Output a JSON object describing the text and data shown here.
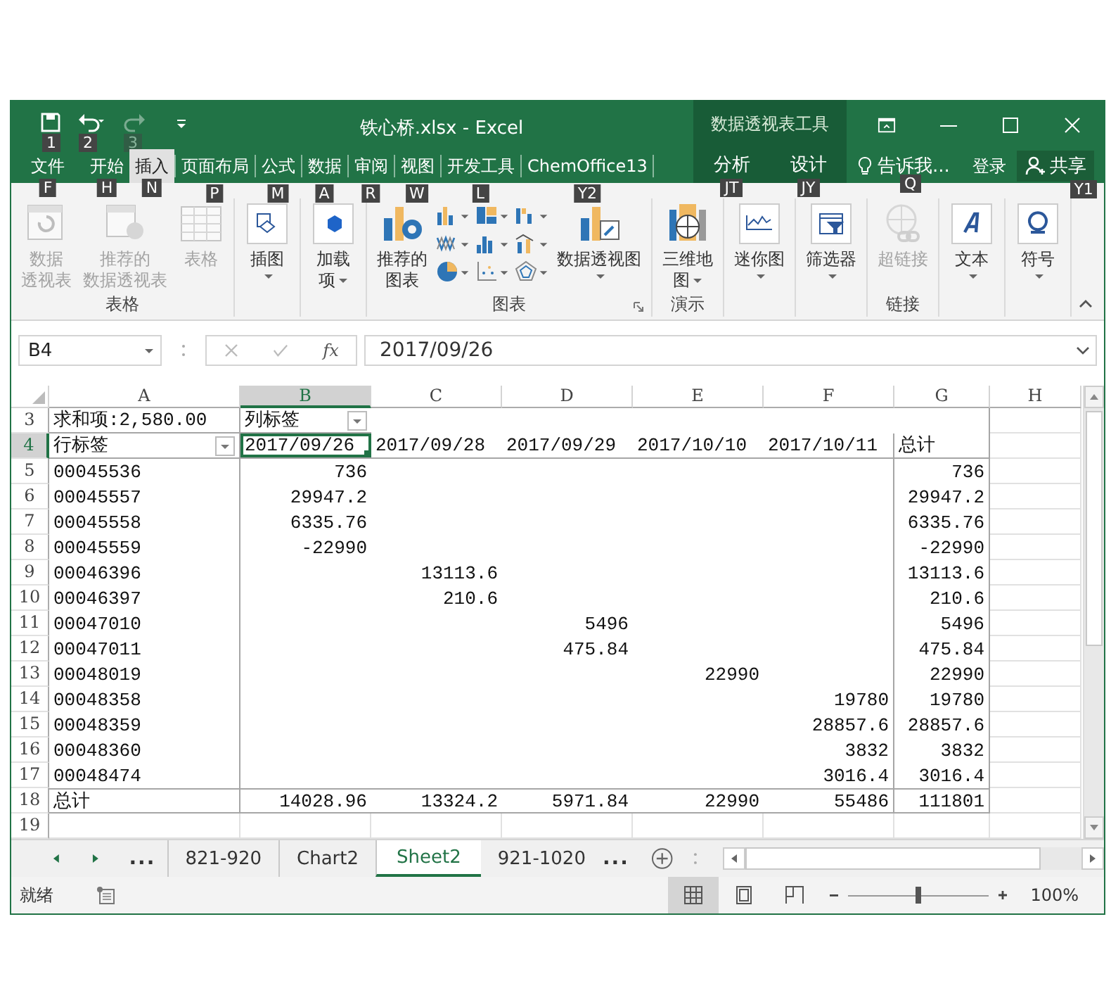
{
  "title_bar": {
    "quick_access": [
      {
        "keytip": "1",
        "disabled": false
      },
      {
        "keytip": "2",
        "disabled": false
      },
      {
        "keytip": "3",
        "disabled": true
      }
    ],
    "title": "铁心桥.xlsx - Excel",
    "contextual_label": "数据透视表工具"
  },
  "tabs": [
    {
      "label": "文件",
      "keytip": "F",
      "selected": false,
      "contextual": false
    },
    {
      "label": "开始",
      "keytip": "H",
      "selected": false,
      "contextual": false
    },
    {
      "label": "插入",
      "keytip": "N",
      "selected": true,
      "contextual": false
    },
    {
      "label": "页面布局",
      "keytip": "P",
      "selected": false,
      "contextual": false
    },
    {
      "label": "公式",
      "keytip": "M",
      "selected": false,
      "contextual": false
    },
    {
      "label": "数据",
      "keytip": "A",
      "selected": false,
      "contextual": false
    },
    {
      "label": "审阅",
      "keytip": "R",
      "selected": false,
      "contextual": false
    },
    {
      "label": "视图",
      "keytip": "W",
      "selected": false,
      "contextual": false
    },
    {
      "label": "开发工具",
      "keytip": "L",
      "selected": false,
      "contextual": false
    },
    {
      "label": "ChemOffice13",
      "keytip": "Y2",
      "selected": false,
      "contextual": false
    },
    {
      "label": "分析",
      "keytip": "JT",
      "selected": false,
      "contextual": true
    },
    {
      "label": "设计",
      "keytip": "JY",
      "selected": false,
      "contextual": true
    }
  ],
  "tell_me": {
    "placeholder": "告诉我...",
    "keytip": "Q"
  },
  "sign_in": "登录",
  "share": {
    "label": "共享",
    "keytip": "Y1"
  },
  "ribbon": {
    "groups": [
      {
        "label": "表格",
        "items": [
          {
            "kind": "large",
            "lines": [
              "数据",
              "透视表"
            ],
            "disabled": true,
            "dropdown": false
          },
          {
            "kind": "large",
            "lines": [
              "推荐的",
              "数据透视表"
            ],
            "disabled": true,
            "dropdown": false
          },
          {
            "kind": "large",
            "lines": [
              "表格"
            ],
            "disabled": true,
            "dropdown": false
          }
        ]
      },
      {
        "items": [
          {
            "kind": "large",
            "lines": [
              "插图"
            ],
            "disabled": false,
            "dropdown": true
          }
        ]
      },
      {
        "items": [
          {
            "kind": "large",
            "lines": [
              "加载",
              "项"
            ],
            "disabled": false,
            "dropdown": true
          }
        ]
      },
      {
        "label": "图表",
        "launcher": true,
        "items": [
          {
            "kind": "large",
            "lines": [
              "推荐的",
              "图表"
            ],
            "disabled": false,
            "dropdown": false
          },
          {
            "kind": "chart_gallery"
          },
          {
            "kind": "large",
            "lines": [
              "数据透视图"
            ],
            "disabled": false,
            "dropdown": true
          }
        ]
      },
      {
        "label": "演示",
        "items": [
          {
            "kind": "large",
            "lines": [
              "三维地",
              "图"
            ],
            "disabled": false,
            "dropdown": true
          }
        ]
      },
      {
        "items": [
          {
            "kind": "large",
            "lines": [
              "迷你图"
            ],
            "disabled": false,
            "dropdown": true
          }
        ]
      },
      {
        "items": [
          {
            "kind": "large",
            "lines": [
              "筛选器"
            ],
            "disabled": false,
            "dropdown": true
          }
        ]
      },
      {
        "label": "链接",
        "items": [
          {
            "kind": "large",
            "lines": [
              "超链接"
            ],
            "disabled": true,
            "dropdown": false
          }
        ]
      },
      {
        "items": [
          {
            "kind": "large",
            "lines": [
              "文本"
            ],
            "disabled": false,
            "dropdown": true
          }
        ]
      },
      {
        "items": [
          {
            "kind": "large",
            "lines": [
              "符号"
            ],
            "disabled": false,
            "dropdown": true
          }
        ]
      }
    ]
  },
  "formula_bar": {
    "name_box": "B4",
    "function_label": "fx",
    "value": "2017/09/26"
  },
  "grid": {
    "columns": [
      {
        "label": "A",
        "selected": false
      },
      {
        "label": "B",
        "selected": true
      },
      {
        "label": "C",
        "selected": false
      },
      {
        "label": "D",
        "selected": false
      },
      {
        "label": "E",
        "selected": false
      },
      {
        "label": "F",
        "selected": false
      },
      {
        "label": "G",
        "selected": false
      },
      {
        "label": "H",
        "selected": false
      }
    ],
    "rows": [
      {
        "number": "3",
        "selected": false,
        "kind": "filter",
        "cells": [
          "求和项:2,580.00",
          {
            "text": "列标签",
            "filter": true
          },
          null,
          null,
          null,
          null,
          null,
          null
        ]
      },
      {
        "number": "4",
        "selected": true,
        "kind": "header",
        "cells": [
          {
            "text": "行标签",
            "filter": true
          },
          {
            "text": "2017/09/26",
            "active": true
          },
          "2017/09/28",
          "2017/09/29",
          "2017/10/10",
          "2017/10/11",
          "总计",
          null
        ]
      },
      {
        "number": "5",
        "selected": false,
        "kind": "data",
        "cells": [
          "00045536",
          "736",
          null,
          null,
          null,
          null,
          "736",
          null
        ]
      },
      {
        "number": "6",
        "selected": false,
        "kind": "data",
        "cells": [
          "00045557",
          "29947.2",
          null,
          null,
          null,
          null,
          "29947.2",
          null
        ]
      },
      {
        "number": "7",
        "selected": false,
        "kind": "data",
        "cells": [
          "00045558",
          "6335.76",
          null,
          null,
          null,
          null,
          "6335.76",
          null
        ]
      },
      {
        "number": "8",
        "selected": false,
        "kind": "data",
        "cells": [
          "00045559",
          "-22990",
          null,
          null,
          null,
          null,
          "-22990",
          null
        ]
      },
      {
        "number": "9",
        "selected": false,
        "kind": "data",
        "cells": [
          "00046396",
          null,
          "13113.6",
          null,
          null,
          null,
          "13113.6",
          null
        ]
      },
      {
        "number": "10",
        "selected": false,
        "kind": "data",
        "cells": [
          "00046397",
          null,
          "210.6",
          null,
          null,
          null,
          "210.6",
          null
        ]
      },
      {
        "number": "11",
        "selected": false,
        "kind": "data",
        "cells": [
          "00047010",
          null,
          null,
          "5496",
          null,
          null,
          "5496",
          null
        ]
      },
      {
        "number": "12",
        "selected": false,
        "kind": "data",
        "cells": [
          "00047011",
          null,
          null,
          "475.84",
          null,
          null,
          "475.84",
          null
        ]
      },
      {
        "number": "13",
        "selected": false,
        "kind": "data",
        "cells": [
          "00048019",
          null,
          null,
          null,
          "22990",
          null,
          "22990",
          null
        ]
      },
      {
        "number": "14",
        "selected": false,
        "kind": "data",
        "cells": [
          "00048358",
          null,
          null,
          null,
          null,
          "19780",
          "19780",
          null
        ]
      },
      {
        "number": "15",
        "selected": false,
        "kind": "data",
        "cells": [
          "00048359",
          null,
          null,
          null,
          null,
          "28857.6",
          "28857.6",
          null
        ]
      },
      {
        "number": "16",
        "selected": false,
        "kind": "data",
        "cells": [
          "00048360",
          null,
          null,
          null,
          null,
          "3832",
          "3832",
          null
        ]
      },
      {
        "number": "17",
        "selected": false,
        "kind": "data",
        "cells": [
          "00048474",
          null,
          null,
          null,
          null,
          "3016.4",
          "3016.4",
          null
        ]
      },
      {
        "number": "18",
        "selected": false,
        "kind": "total",
        "cells": [
          "总计",
          "14028.96",
          "13324.2",
          "5971.84",
          "22990",
          "55486",
          "111801",
          null
        ]
      },
      {
        "number": "19",
        "selected": false,
        "kind": "blank",
        "cells": [
          null,
          null,
          null,
          null,
          null,
          null,
          null,
          null
        ]
      }
    ]
  },
  "sheet_bar": {
    "more_left": "...",
    "more_right": "...",
    "tabs": [
      {
        "label": "821-920",
        "selected": false
      },
      {
        "label": "Chart2",
        "selected": false
      },
      {
        "label": "Sheet2",
        "selected": true
      },
      {
        "label": "921-1020",
        "selected": false
      }
    ]
  },
  "status_bar": {
    "status": "就绪",
    "views": [
      {
        "selected": true
      },
      {
        "selected": false
      },
      {
        "selected": false
      }
    ],
    "zoom": {
      "level": 0.5,
      "reading": "100%"
    }
  }
}
